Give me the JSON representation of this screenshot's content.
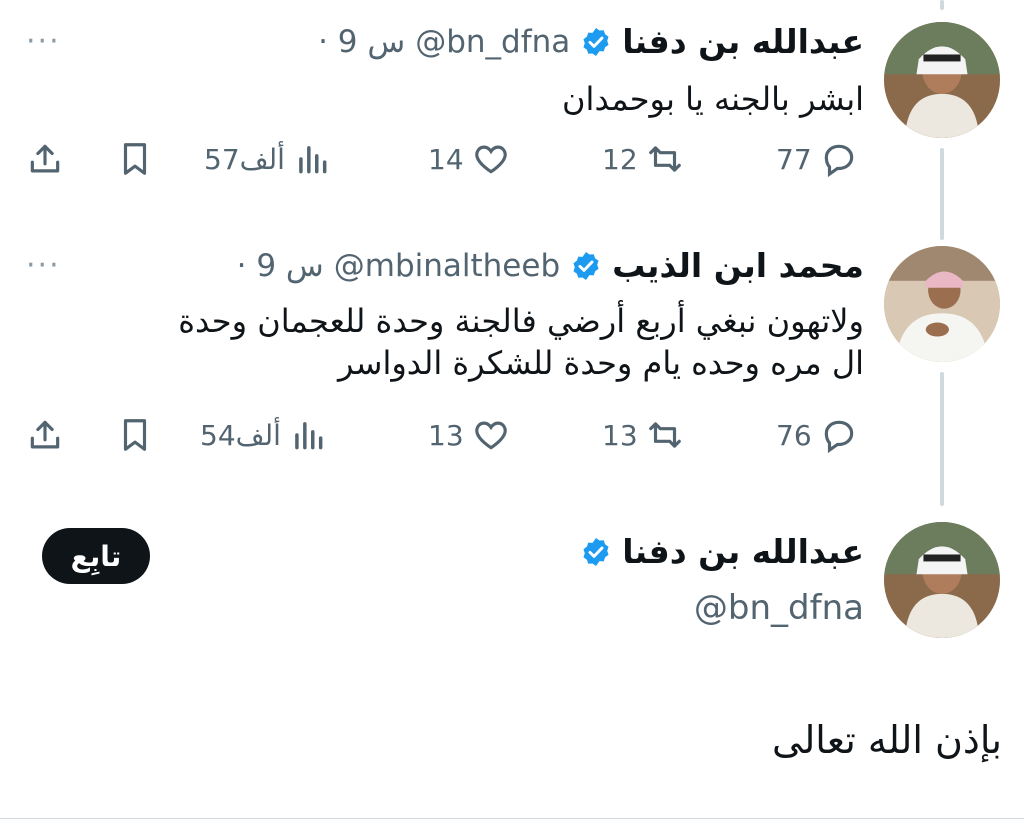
{
  "colors": {
    "verified_blue": "#1d9bf0",
    "text_primary": "#0f1419",
    "text_secondary": "#536471",
    "thread_line": "#cfd9de"
  },
  "tweets": [
    {
      "name": "عبدالله بن دفنا",
      "handle": "@bn_dfna",
      "time": "· 9 س",
      "text_lines": [
        "ابشر بالجنه يا بوحمدان"
      ],
      "replies": "77",
      "retweets": "12",
      "likes": "14",
      "views": "57ألف",
      "more": "···"
    },
    {
      "name": "محمد ابن الذيب",
      "handle": "@mbinaltheeb",
      "time": "· 9 س",
      "text_lines": [
        "ولاتهون نبغي أربع أرضي فالجنة وحدة للعجمان وحدة",
        "ال مره وحده يام وحدة للشكرة الدواسر"
      ],
      "replies": "76",
      "retweets": "13",
      "likes": "13",
      "views": "54ألف",
      "more": "···"
    }
  ],
  "main_tweet": {
    "name": "عبدالله بن دفنا",
    "handle": "@bn_dfna",
    "follow_label": "تابِع",
    "text": "بإذن الله تعالى"
  }
}
